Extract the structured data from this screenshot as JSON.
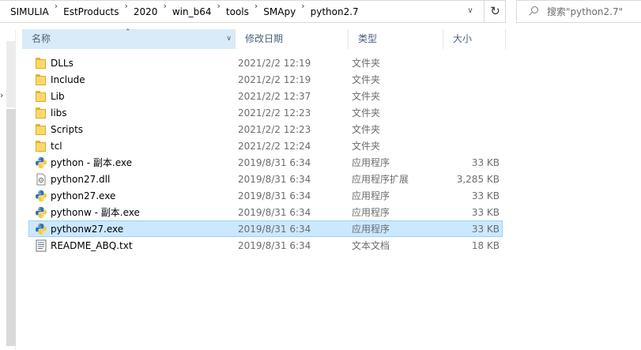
{
  "address": {
    "crumbs": [
      "SIMULIA",
      "EstProducts",
      "2020",
      "win_b64",
      "tools",
      "SMApy",
      "python2.7"
    ],
    "separator": "›"
  },
  "search": {
    "placeholder": "搜索\"python2.7\""
  },
  "icons": {
    "refresh": "refresh-icon",
    "dropdown": "chevron-down-icon",
    "search": "search-icon"
  },
  "columns": {
    "name": "名称",
    "date": "修改日期",
    "type": "类型",
    "size": "大小"
  },
  "files": [
    {
      "name": "DLLs",
      "date": "2021/2/2 12:19",
      "type": "文件夹",
      "size": "",
      "icon": "folder"
    },
    {
      "name": "Include",
      "date": "2021/2/2 12:19",
      "type": "文件夹",
      "size": "",
      "icon": "folder"
    },
    {
      "name": "Lib",
      "date": "2021/2/2 12:37",
      "type": "文件夹",
      "size": "",
      "icon": "folder"
    },
    {
      "name": "libs",
      "date": "2021/2/2 12:23",
      "type": "文件夹",
      "size": "",
      "icon": "folder"
    },
    {
      "name": "Scripts",
      "date": "2021/2/2 12:23",
      "type": "文件夹",
      "size": "",
      "icon": "folder"
    },
    {
      "name": "tcl",
      "date": "2021/2/2 12:24",
      "type": "文件夹",
      "size": "",
      "icon": "folder"
    },
    {
      "name": "python - 副本.exe",
      "date": "2019/8/31 6:34",
      "type": "应用程序",
      "size": "33 KB",
      "icon": "python"
    },
    {
      "name": "python27.dll",
      "date": "2019/8/31 6:34",
      "type": "应用程序扩展",
      "size": "3,285 KB",
      "icon": "dll"
    },
    {
      "name": "python27.exe",
      "date": "2019/8/31 6:34",
      "type": "应用程序",
      "size": "33 KB",
      "icon": "python"
    },
    {
      "name": "pythonw - 副本.exe",
      "date": "2019/8/31 6:34",
      "type": "应用程序",
      "size": "33 KB",
      "icon": "python"
    },
    {
      "name": "pythonw27.exe",
      "date": "2019/8/31 6:34",
      "type": "应用程序",
      "size": "33 KB",
      "icon": "python",
      "selected": true
    },
    {
      "name": "README_ABQ.txt",
      "date": "2019/8/31 6:34",
      "type": "文本文档",
      "size": "18 KB",
      "icon": "text"
    }
  ],
  "colors": {
    "selection_bg": "#cce8ff",
    "selection_border": "#99d1ff",
    "header_text": "#4c607a",
    "folder": "#ffd869"
  }
}
